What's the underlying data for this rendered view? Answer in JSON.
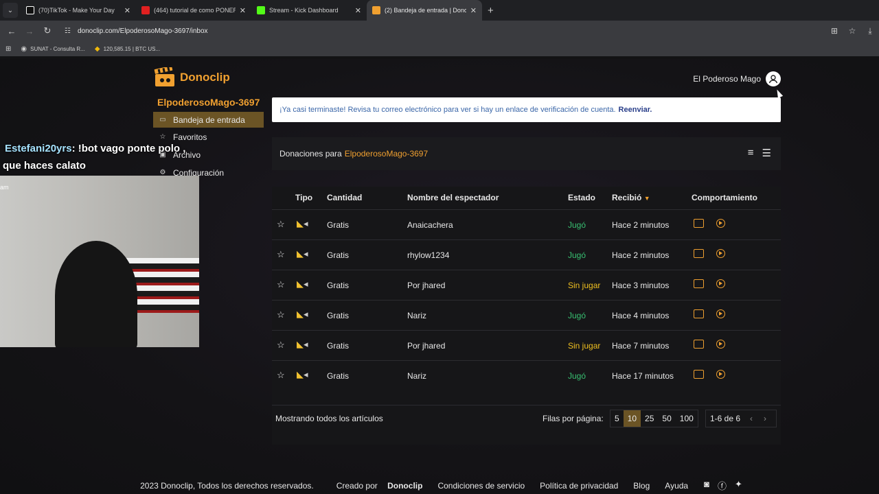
{
  "browser": {
    "tabs": [
      {
        "title": "(70)TikTok - Make Your Day",
        "icon": "tiktok-icon",
        "color": "#ffffff"
      },
      {
        "title": "(464) tutorial de como PONER",
        "icon": "youtube-icon",
        "color": "#e02020"
      },
      {
        "title": "Stream - Kick Dashboard",
        "icon": "kick-icon",
        "color": "#53fc18"
      },
      {
        "title": "(2) Bandeja de entrada | Donoc",
        "icon": "donoclip-icon",
        "color": "#f0a030"
      }
    ],
    "url": "donoclip.com/ElpoderosoMago-3697/inbox",
    "bookmarks": [
      {
        "label": "SUNAT - Consulta R..."
      },
      {
        "label": "120,585.15 | BTC US..."
      }
    ]
  },
  "header": {
    "brand": "Donoclip",
    "user_name": "El Poderoso Mago"
  },
  "sidebar": {
    "title": "ElpoderosoMago-3697",
    "items": [
      {
        "label": "Bandeja de entrada",
        "icon": "inbox-icon"
      },
      {
        "label": "Favoritos",
        "icon": "star-icon"
      },
      {
        "label": "Archivo",
        "icon": "archive-icon"
      },
      {
        "label": "Configuración",
        "icon": "settings-icon"
      }
    ]
  },
  "alert": {
    "text": "¡Ya casi terminaste! Revisa tu correo electrónico para ver si hay un enlace de verificación de cuenta.",
    "link": "Reenviar."
  },
  "donations": {
    "prefix": "Donaciones para",
    "channel": "ElpoderosoMago-3697"
  },
  "table": {
    "headers": [
      "Tipo",
      "Cantidad",
      "Nombre del espectador",
      "Estado",
      "Recibió",
      "Comportamiento"
    ],
    "rows": [
      {
        "cantidad": "Gratis",
        "nombre": "Anaicachera",
        "estado": "Jugó",
        "recibio": "Hace 2 minutos"
      },
      {
        "cantidad": "Gratis",
        "nombre": "rhylow1234",
        "estado": "Jugó",
        "recibio": "Hace 2 minutos"
      },
      {
        "cantidad": "Gratis",
        "nombre": "Por jhared",
        "estado": "Sin jugar",
        "recibio": "Hace 3 minutos"
      },
      {
        "cantidad": "Gratis",
        "nombre": "Nariz",
        "estado": "Jugó",
        "recibio": "Hace 4 minutos"
      },
      {
        "cantidad": "Gratis",
        "nombre": "Por jhared",
        "estado": "Sin jugar",
        "recibio": "Hace 7 minutos"
      },
      {
        "cantidad": "Gratis",
        "nombre": "Nariz",
        "estado": "Jugó",
        "recibio": "Hace 17 minutos"
      }
    ]
  },
  "pagination": {
    "showing": "Mostrando todos los artículos",
    "rows_label": "Filas por página:",
    "options": [
      "5",
      "10",
      "25",
      "50",
      "100"
    ],
    "selected": "10",
    "range": "1-6 de 6"
  },
  "footer": {
    "copyright": "2023 Donoclip, Todos los derechos reservados.",
    "created_prefix": "Creado por",
    "created_brand": "Donoclip",
    "links": [
      "Condiciones de servicio",
      "Política de privacidad",
      "Blog",
      "Ayuda"
    ]
  },
  "overlay": {
    "chat_nick": "Estefani20yrs",
    "chat_msg": ": !bot vago ponte polo ,",
    "chat_msg2": "que haces calato",
    "cam_label": "am"
  },
  "colors": {
    "accent": "#f0a030",
    "played": "#38c172",
    "unplayed": "#f0c020"
  }
}
